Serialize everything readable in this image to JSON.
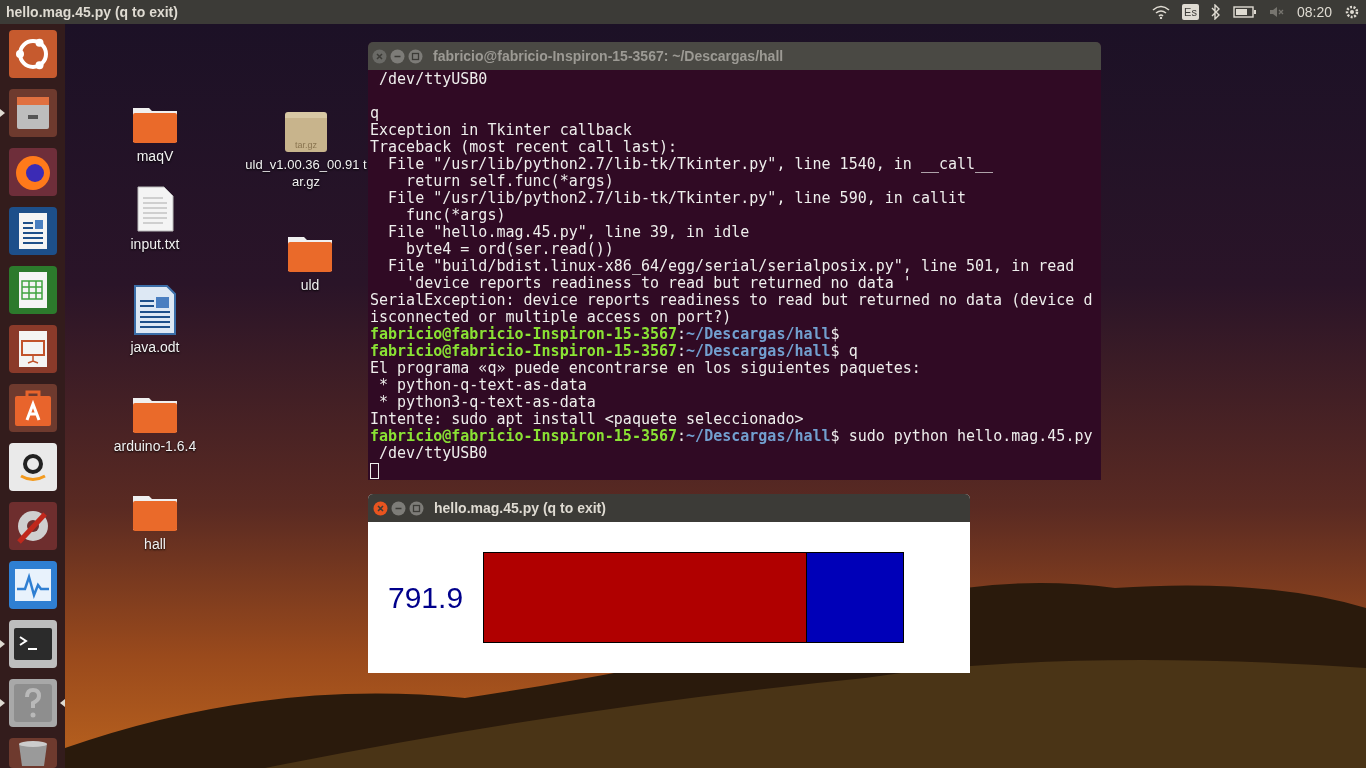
{
  "top_bar": {
    "title": "hello.mag.45.py (q to exit)",
    "keyboard": "Es",
    "time": "08:20"
  },
  "launcher": [
    {
      "kind": "ubuntu",
      "running": false,
      "focused": false
    },
    {
      "kind": "files",
      "running": true,
      "focused": false
    },
    {
      "kind": "browser",
      "running": false,
      "focused": false
    },
    {
      "kind": "writer",
      "running": false,
      "focused": false
    },
    {
      "kind": "calc",
      "running": false,
      "focused": false
    },
    {
      "kind": "impress",
      "running": false,
      "focused": false
    },
    {
      "kind": "store",
      "running": false,
      "focused": false
    },
    {
      "kind": "amazon",
      "running": false,
      "focused": false
    },
    {
      "kind": "settings",
      "running": false,
      "focused": false
    },
    {
      "kind": "monitor",
      "running": false,
      "focused": false
    },
    {
      "kind": "terminal",
      "running": true,
      "focused": false
    },
    {
      "kind": "unknown",
      "running": true,
      "focused": true
    },
    {
      "kind": "trash",
      "running": false,
      "focused": false
    }
  ],
  "desktop_icons": [
    {
      "kind": "folder",
      "label": "maqV"
    },
    {
      "kind": "text",
      "label": "input.txt"
    },
    {
      "kind": "document",
      "label": "java.odt"
    },
    {
      "kind": "folder",
      "label": "arduino-1.6.4"
    },
    {
      "kind": "folder",
      "label": "hall"
    },
    {
      "kind": "archive",
      "label": "uld_v1.00.36_00.91 tar.gz",
      "badge": "tar.gz"
    },
    {
      "kind": "folder",
      "label": "uld"
    }
  ],
  "terminal": {
    "title": "fabricio@fabricio-Inspiron-15-3567: ~/Descargas/hall",
    "lines": [
      {
        "kind": "text",
        "text": " /dev/ttyUSB0"
      },
      {
        "kind": "blank"
      },
      {
        "kind": "text",
        "text": "q"
      },
      {
        "kind": "text",
        "text": "Exception in Tkinter callback"
      },
      {
        "kind": "text",
        "text": "Traceback (most recent call last):"
      },
      {
        "kind": "text",
        "text": "  File \"/usr/lib/python2.7/lib-tk/Tkinter.py\", line 1540, in __call__"
      },
      {
        "kind": "text",
        "text": "    return self.func(*args)"
      },
      {
        "kind": "text",
        "text": "  File \"/usr/lib/python2.7/lib-tk/Tkinter.py\", line 590, in callit"
      },
      {
        "kind": "text",
        "text": "    func(*args)"
      },
      {
        "kind": "text",
        "text": "  File \"hello.mag.45.py\", line 39, in idle"
      },
      {
        "kind": "text",
        "text": "    byte4 = ord(ser.read())"
      },
      {
        "kind": "text",
        "text": "  File \"build/bdist.linux-x86_64/egg/serial/serialposix.py\", line 501, in read"
      },
      {
        "kind": "text",
        "text": "    'device reports readiness to read but returned no data '"
      },
      {
        "kind": "text",
        "text": "SerialException: device reports readiness to read but returned no data (device d"
      },
      {
        "kind": "text",
        "text": "isconnected or multiple access on port?)"
      },
      {
        "kind": "prompt",
        "user": "fabricio@fabricio-Inspiron-15-3567",
        "sep": ":",
        "path": "~/Descargas/hall",
        "end": "$"
      },
      {
        "kind": "prompt",
        "user": "fabricio@fabricio-Inspiron-15-3567",
        "sep": ":",
        "path": "~/Descargas/hall",
        "end": "$",
        "command": "q"
      },
      {
        "kind": "text",
        "text": "El programa «q» puede encontrarse en los siguientes paquetes:"
      },
      {
        "kind": "text",
        "text": " * python-q-text-as-data"
      },
      {
        "kind": "text",
        "text": " * python3-q-text-as-data"
      },
      {
        "kind": "text",
        "text": "Intente: sudo apt install <paquete seleccionado>"
      },
      {
        "kind": "prompt",
        "user": "fabricio@fabricio-Inspiron-15-3567",
        "sep": ":",
        "path": "~/Descargas/hall",
        "end": "$",
        "command": "sudo python hello.mag.45.py"
      },
      {
        "kind": "text",
        "text": " /dev/ttyUSB0"
      },
      {
        "kind": "cursor"
      }
    ]
  },
  "tk_window": {
    "title": "hello.mag.45.py (q to exit)",
    "reading": "791.9",
    "level": 0.77
  }
}
